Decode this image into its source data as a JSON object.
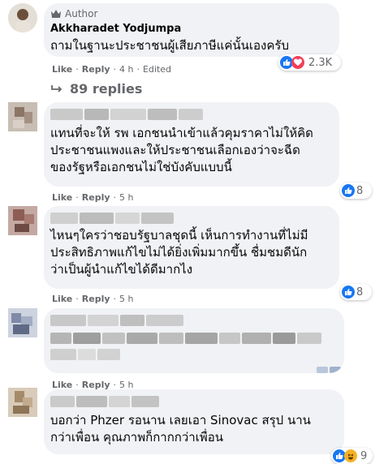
{
  "author_comment": {
    "badge": "Author",
    "name": "Akkharadet Yodjumpa",
    "text": "ถามในฐานะประชาชนผู้เสียภาษีแค่นั้นเองครับ",
    "actions": {
      "like": "Like",
      "reply": "Reply",
      "time": "4 h",
      "edited": "Edited"
    },
    "reaction_count": "2.3K"
  },
  "replies_link": "89 replies",
  "comments": [
    {
      "lines": [
        "แทนที่จะให้ รพ เอกชนนำเข้าแล้วคุมราคาไม่ให้คิด",
        "ประชาชนแพงและให้ประชาชนเลือกเองว่าจะฉีด",
        "ของรัฐหรือเอกชนไม่ใช่บังคับแบบนี้"
      ],
      "actions": {
        "like": "Like",
        "reply": "Reply",
        "time": "5 h"
      },
      "reaction_count": "8"
    },
    {
      "lines": [
        "ไหนๆใครว่าชอบรัฐบาลชุดนี้ เห็นการทำงานที่ไม่มี",
        "ประสิทธิภาพแก้ไขไม่ได้ยิ่งเพิ่มมากขึ้น ชื่มชมดีนัก",
        "ว่าเป็นผู้นำแก้ไขได้ดีมากไง"
      ],
      "actions": {
        "like": "Like",
        "reply": "Reply",
        "time": "5 h"
      },
      "reaction_count": "8"
    },
    {
      "actions": {
        "like": "Like",
        "reply": "Reply",
        "time": "5 h"
      }
    },
    {
      "lines": [
        "บอกว่า Phzer รอนาน เลยเอา Sinovac สรุป นาน",
        "กว่าเพื่อน คุณภาพก็กากกว่าเพื่อน"
      ],
      "reaction_count": "9"
    }
  ],
  "colors": {
    "like_blue": "#1877f2",
    "love_red": "#f33e58",
    "haha_yellow": "#f7b125",
    "bubble_gray": "#f0f2f5"
  },
  "icons": [
    "author-badge-icon",
    "like-reaction-icon",
    "love-reaction-icon",
    "haha-reaction-icon",
    "reply-arrow-icon"
  ]
}
